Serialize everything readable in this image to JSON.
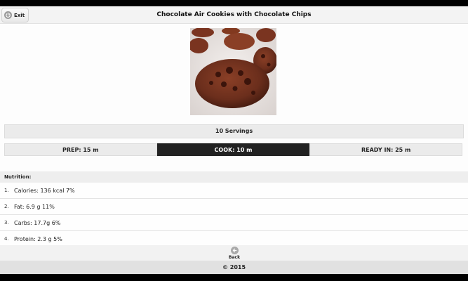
{
  "header": {
    "exit_label": "Exit",
    "title": "Chocolate Air Cookies with Chocolate Chips"
  },
  "recipe": {
    "image_icon": "cookie-photo",
    "servings": "10 Servings",
    "times": [
      {
        "label": "PREP: 15 m",
        "active": false
      },
      {
        "label": "COOK: 10 m",
        "active": true
      },
      {
        "label": "READY IN: 25 m",
        "active": false
      }
    ]
  },
  "nutrition": {
    "heading": "Nutrition:",
    "items": [
      {
        "num": "1.",
        "text": "Calories: 136 kcal 7%"
      },
      {
        "num": "2.",
        "text": "Fat: 6.9 g 11%"
      },
      {
        "num": "3.",
        "text": "Carbs: 17.7g 6%"
      },
      {
        "num": "4.",
        "text": "Protein: 2.3 g 5%"
      }
    ]
  },
  "footer": {
    "back_label": "Back",
    "copyright": "© 2015"
  },
  "colors": {
    "active_segment": "#222222",
    "bar_background": "#ebebeb",
    "cookie_brown": "#6b2e1c"
  }
}
